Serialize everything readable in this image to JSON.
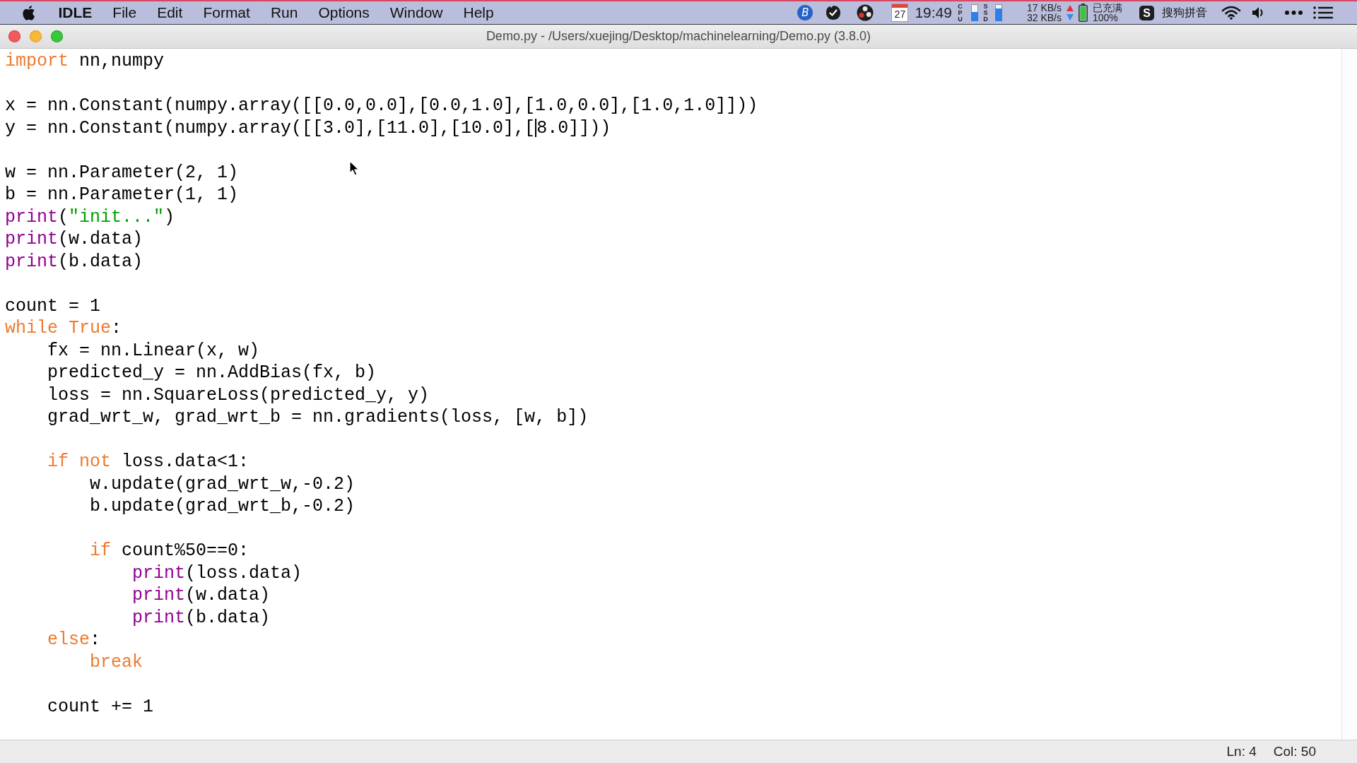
{
  "menu_bar": {
    "app_name": "IDLE",
    "menus": [
      "File",
      "Edit",
      "Format",
      "Run",
      "Options",
      "Window",
      "Help"
    ],
    "status_menu": {
      "badge_letter": "B",
      "calendar_day": "27",
      "clock": "19:49",
      "cpu": {
        "label": "CPU",
        "level": 0.55
      },
      "ssd": {
        "label": "SSD",
        "level": 0.75
      },
      "network": {
        "upload": "17 KB/s",
        "download": "32 KB/s"
      },
      "battery": {
        "status": "已充满",
        "percent": "100%"
      },
      "input_method": {
        "letter": "S",
        "name": "搜狗拼音"
      }
    }
  },
  "window": {
    "title": "Demo.py - /Users/xuejing/Desktop/machinelearning/Demo.py (3.8.0)",
    "code_lines": [
      {
        "kind": "code",
        "tokens": [
          {
            "kind": "keyword",
            "text": "import"
          },
          {
            "kind": "plain",
            "text": " nn,numpy"
          }
        ]
      },
      {
        "kind": "blank"
      },
      {
        "kind": "code",
        "tokens": [
          {
            "kind": "plain",
            "text": "x = nn.Constant(numpy.array([[0.0,0.0],[0.0,1.0],[1.0,0.0],[1.0,1.0]]))"
          }
        ]
      },
      {
        "kind": "code",
        "tokens": [
          {
            "kind": "plain",
            "text": "y = nn.Constant(numpy.array([[3.0],[11.0],[10.0],["
          },
          {
            "kind": "caret"
          },
          {
            "kind": "plain",
            "text": "8.0]]))"
          }
        ]
      },
      {
        "kind": "blank"
      },
      {
        "kind": "code",
        "tokens": [
          {
            "kind": "plain",
            "text": "w = nn.Parameter(2, 1)"
          }
        ]
      },
      {
        "kind": "code",
        "tokens": [
          {
            "kind": "plain",
            "text": "b = nn.Parameter(1, 1)"
          }
        ]
      },
      {
        "kind": "code",
        "tokens": [
          {
            "kind": "builtin",
            "text": "print"
          },
          {
            "kind": "plain",
            "text": "("
          },
          {
            "kind": "string",
            "text": "\"init...\""
          },
          {
            "kind": "plain",
            "text": ")"
          }
        ]
      },
      {
        "kind": "code",
        "tokens": [
          {
            "kind": "builtin",
            "text": "print"
          },
          {
            "kind": "plain",
            "text": "(w.data)"
          }
        ]
      },
      {
        "kind": "code",
        "tokens": [
          {
            "kind": "builtin",
            "text": "print"
          },
          {
            "kind": "plain",
            "text": "(b.data)"
          }
        ]
      },
      {
        "kind": "blank"
      },
      {
        "kind": "code",
        "tokens": [
          {
            "kind": "plain",
            "text": "count = 1"
          }
        ]
      },
      {
        "kind": "code",
        "tokens": [
          {
            "kind": "keyword",
            "text": "while"
          },
          {
            "kind": "keyword",
            "text": " True"
          },
          {
            "kind": "plain",
            "text": ":"
          }
        ]
      },
      {
        "kind": "code",
        "tokens": [
          {
            "kind": "plain",
            "text": "    fx = nn.Linear(x, w)"
          }
        ]
      },
      {
        "kind": "code",
        "tokens": [
          {
            "kind": "plain",
            "text": "    predicted_y = nn.AddBias(fx, b)"
          }
        ]
      },
      {
        "kind": "code",
        "tokens": [
          {
            "kind": "plain",
            "text": "    loss = nn.SquareLoss(predicted_y, y)"
          }
        ]
      },
      {
        "kind": "code",
        "tokens": [
          {
            "kind": "plain",
            "text": "    grad_wrt_w, grad_wrt_b = nn.gradients(loss, [w, b])"
          }
        ]
      },
      {
        "kind": "blank"
      },
      {
        "kind": "code",
        "tokens": [
          {
            "kind": "keyword",
            "text": "    if"
          },
          {
            "kind": "keyword",
            "text": " not"
          },
          {
            "kind": "plain",
            "text": " loss.data<1:"
          }
        ]
      },
      {
        "kind": "code",
        "tokens": [
          {
            "kind": "plain",
            "text": "        w.update(grad_wrt_w,-0.2)"
          }
        ]
      },
      {
        "kind": "code",
        "tokens": [
          {
            "kind": "plain",
            "text": "        b.update(grad_wrt_b,-0.2)"
          }
        ]
      },
      {
        "kind": "blank"
      },
      {
        "kind": "code",
        "tokens": [
          {
            "kind": "keyword",
            "text": "        if"
          },
          {
            "kind": "plain",
            "text": " count%50==0:"
          }
        ]
      },
      {
        "kind": "code",
        "tokens": [
          {
            "kind": "builtin",
            "text": "            print"
          },
          {
            "kind": "plain",
            "text": "(loss.data)"
          }
        ]
      },
      {
        "kind": "code",
        "tokens": [
          {
            "kind": "builtin",
            "text": "            print"
          },
          {
            "kind": "plain",
            "text": "(w.data)"
          }
        ]
      },
      {
        "kind": "code",
        "tokens": [
          {
            "kind": "builtin",
            "text": "            print"
          },
          {
            "kind": "plain",
            "text": "(b.data)"
          }
        ]
      },
      {
        "kind": "code",
        "tokens": [
          {
            "kind": "keyword",
            "text": "    else"
          },
          {
            "kind": "plain",
            "text": ":"
          }
        ]
      },
      {
        "kind": "code",
        "tokens": [
          {
            "kind": "keyword",
            "text": "        break"
          }
        ]
      },
      {
        "kind": "blank"
      },
      {
        "kind": "code",
        "tokens": [
          {
            "kind": "plain",
            "text": "    count += 1"
          }
        ]
      }
    ],
    "status_bar": {
      "line": "Ln: 4",
      "column": "Col: 50"
    }
  }
}
